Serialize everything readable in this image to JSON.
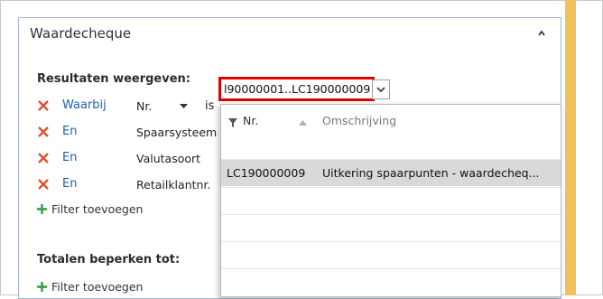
{
  "dialog": {
    "title": "Waardecheque"
  },
  "results": {
    "heading": "Resultaten weergeven:",
    "rows": [
      {
        "operator": "Waarbij",
        "field": "Nr.",
        "comparator": "is"
      },
      {
        "operator": "En",
        "field": "Spaarsysteem"
      },
      {
        "operator": "En",
        "field": "Valutasoort"
      },
      {
        "operator": "En",
        "field": "Retailklantnr."
      }
    ],
    "add_filter": "Filter toevoegen"
  },
  "filter_value": {
    "value": "l90000001..LC190000009"
  },
  "lookup": {
    "columns": {
      "nr": "Nr.",
      "description": "Omschrijving"
    },
    "rows": [
      {
        "nr": "LC190000009",
        "description": "Uitkering spaarpunten - waardecheq..."
      }
    ]
  },
  "totals": {
    "heading": "Totalen beperken tot:",
    "add_filter": "Filter toevoegen"
  },
  "colors": {
    "accent": "#f0c15a",
    "highlight_border": "#e00000",
    "remove_icon": "#e0512b",
    "add_icon": "#2e9e3e",
    "link": "#1f5ea8"
  },
  "icons": {
    "collapse": "chevron-up-icon",
    "remove": "remove-x-icon",
    "add": "plus-icon",
    "dropdown": "chevron-down-icon",
    "filter": "filter-funnel-icon",
    "sort": "sort-ascending-icon"
  }
}
